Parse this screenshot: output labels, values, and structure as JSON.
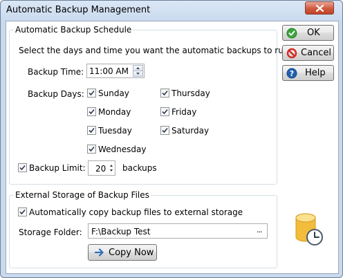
{
  "window": {
    "title": "Automatic Backup Management"
  },
  "schedule": {
    "group_label": "Automatic Backup Schedule",
    "instructions": "Select the days and time you want the automatic backups to run.",
    "time_label": "Backup Time:",
    "time_value": "11:00 AM",
    "days_label": "Backup Days:",
    "days": [
      {
        "label": "Sunday",
        "checked": true
      },
      {
        "label": "Monday",
        "checked": true
      },
      {
        "label": "Tuesday",
        "checked": true
      },
      {
        "label": "Wednesday",
        "checked": true
      },
      {
        "label": "Thursday",
        "checked": true
      },
      {
        "label": "Friday",
        "checked": true
      },
      {
        "label": "Saturday",
        "checked": true
      }
    ],
    "limit_label": "Backup Limit:",
    "limit_checked": true,
    "limit_value": "20",
    "limit_unit": "backups"
  },
  "external": {
    "group_label": "External Storage of Backup Files",
    "auto_copy_label": "Automatically copy backup files to external storage",
    "auto_copy_checked": true,
    "folder_label": "Storage Folder:",
    "folder_value": "F:\\Backup Test",
    "browse_label": "...",
    "copy_now_label": "Copy Now"
  },
  "buttons": {
    "ok_label": "OK",
    "cancel_label": "Cancel",
    "help_label": "Help"
  },
  "icons": {
    "ok": "check-circle-icon",
    "cancel": "no-sign-icon",
    "help": "question-icon",
    "copy_now": "arrow-right-icon",
    "storage": "database-clock-icon",
    "close": "close-icon"
  },
  "colors": {
    "accent_green": "#3aa63a",
    "cancel_red": "#d42a1f",
    "help_blue": "#1f5fae",
    "copy_arrow": "#2f6fb8",
    "database_gold": "#f2bc3c"
  }
}
